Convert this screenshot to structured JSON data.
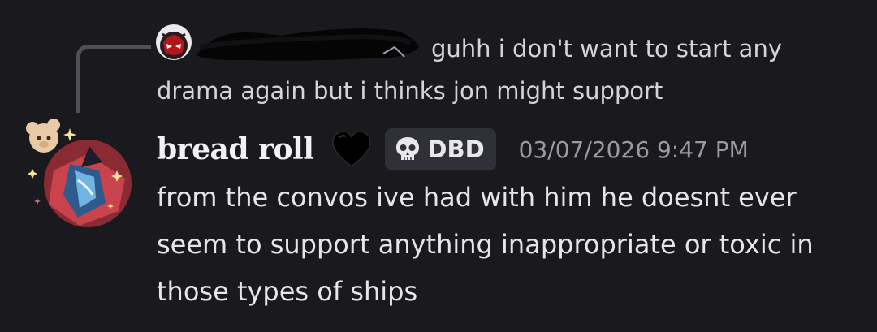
{
  "reply": {
    "author_avatar": "red-masked-hero-avatar",
    "text": "guhh i don't want to start any drama again but i thinks jon might support"
  },
  "message": {
    "avatar": "anime-character-with-teddy-bear-avatar",
    "username": "bread roll",
    "username_decoration": "black-heart-icon",
    "tag": {
      "icon": "skull-icon",
      "label": "DBD"
    },
    "timestamp": "03/07/2026 9:47 PM",
    "text": "from the convos ive had with him he doesnt ever seem to support anything inappropriate or toxic in those types of ships"
  },
  "colors": {
    "background": "#1a1a1e",
    "text_primary": "#e5e5ea",
    "text_muted": "#9a9aa3",
    "tag_background": "#2f3038",
    "connector": "#505058"
  }
}
